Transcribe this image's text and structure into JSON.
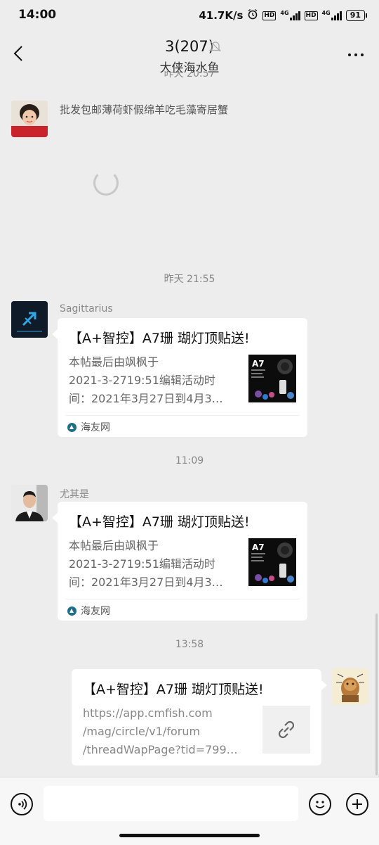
{
  "status_bar": {
    "time": "14:00",
    "net_speed": "41.7K/s",
    "hd1": "HD",
    "net1": "4G",
    "hd2": "HD",
    "net2": "4G",
    "battery": "91"
  },
  "nav": {
    "title": "3(207)",
    "subtitle": "大侠海水鱼"
  },
  "partial_time": "昨天 20:57",
  "messages": [
    {
      "text": "批发包邮薄荷虾假绵羊吃毛藻寄居蟹"
    }
  ],
  "time_labels": [
    "昨天 21:55",
    "11:09",
    "13:58"
  ],
  "cards": [
    {
      "sender": "Sagittarius",
      "title": "【A+智控】A7珊 瑚灯顶贴送!",
      "desc": [
        "本帖最后由飒枫于",
        "2021-3-2719:51编辑活动时",
        "间：2021年3月27日到4月3…"
      ],
      "source": "海友网"
    },
    {
      "sender": "尤其是",
      "title": "【A+智控】A7珊 瑚灯顶贴送!",
      "desc": [
        "本帖最后由飒枫于",
        "2021-3-2719:51编辑活动时",
        "间：2021年3月27日到4月3…"
      ],
      "source": "海友网"
    },
    {
      "title": "【A+智控】A7珊 瑚灯顶贴送!",
      "desc": [
        "https://app.cmfish.com",
        "/mag/circle/v1/forum",
        "/threadWapPage?tid=799…"
      ]
    }
  ],
  "thumb_label": "A7",
  "colors": {
    "background": "#ededed",
    "bubble": "#ffffff",
    "source_icon": "#1e6f86"
  }
}
